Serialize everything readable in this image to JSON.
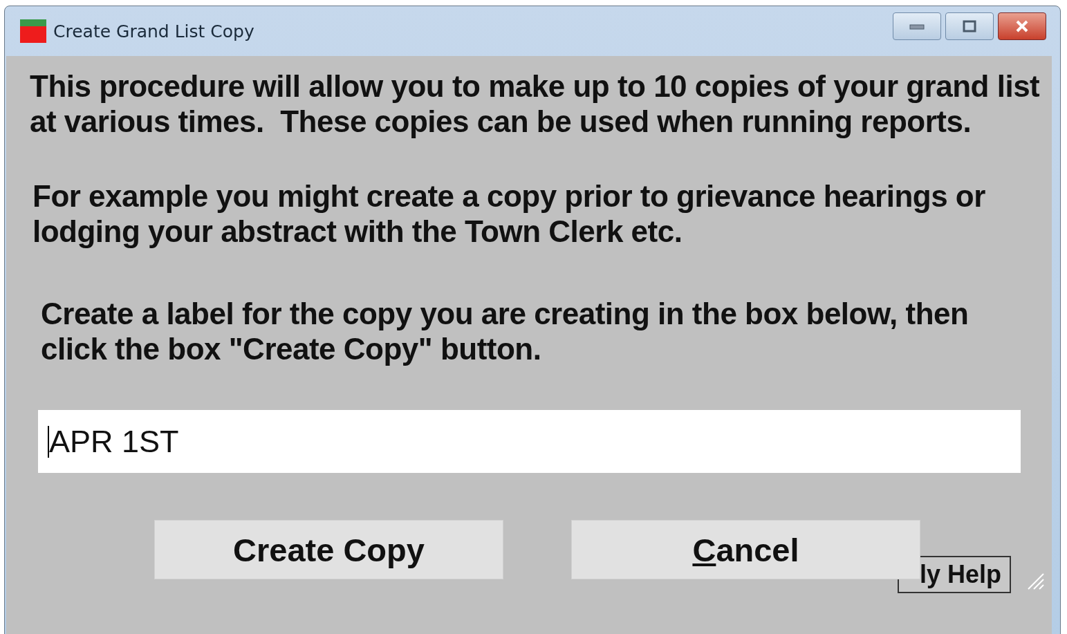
{
  "window": {
    "title": "Create Grand List Copy"
  },
  "paragraphs": [
    "This procedure will allow you to make up to 10 copies of your grand list at various times.  These copies can be used when running reports.",
    "For example you might create a copy prior to grievance hearings or lodging your abstract with the Town Clerk etc.",
    "Create a label for the copy you are creating in the box below, then click the box \"Create Copy\" button."
  ],
  "label_field": {
    "value": "APR 1ST"
  },
  "buttons": [
    {
      "label": "Create Copy",
      "mnemonic": false
    },
    {
      "label": "Cancel",
      "mnemonic": true
    }
  ],
  "help_button": {
    "label": "ly Help"
  }
}
